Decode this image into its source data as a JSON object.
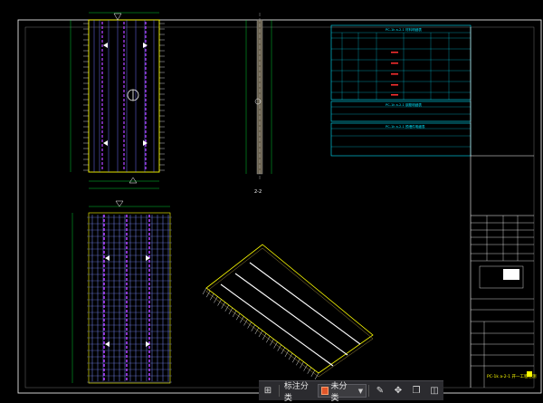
{
  "title_block": {
    "spec_title": "PC-1k a-2-1 开一工程检测"
  },
  "tables": {
    "table1_title": "PC-1k a-2-1 材料明细表",
    "table2_title": "PC-1k a-2-1 钢筋明细表",
    "table3_title": "PC-1k a-2-1 预埋件明细表"
  },
  "views": {
    "section_label": "2-2"
  },
  "toolbar": {
    "grid_icon": "grid-icon",
    "annotate_label": "标注分类",
    "category_label": "未分类",
    "category_color": "#e0562a",
    "icons": [
      "edit-icon",
      "move-icon",
      "copy-icon",
      "layers-icon"
    ]
  },
  "colors": {
    "frame": "#ffffff",
    "table": "#00e5ff",
    "outline": "#ffff00",
    "rebar": "#8080ff",
    "purple": "#b040ff",
    "highlight": "#ff3030",
    "dim": "#00ff40"
  }
}
